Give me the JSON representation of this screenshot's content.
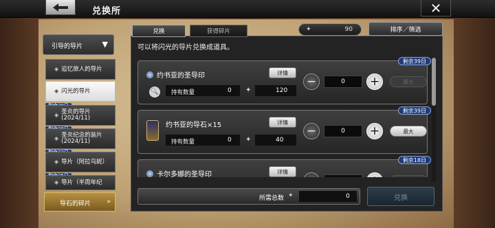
{
  "window": {
    "title": "兑换所"
  },
  "sidebar": {
    "parent_label": "引导的导片",
    "items": [
      {
        "label": "追忆旅人的导片",
        "tag": "",
        "active": false
      },
      {
        "label": "闪光的导片",
        "tag": "",
        "active": true
      },
      {
        "label": "圣炎的导片\n(2024/11)",
        "tag": "剩余39日",
        "active": false
      },
      {
        "label": "圣炎纪念的装片\n(2024/11)",
        "tag": "剩余39日",
        "active": false
      },
      {
        "label": "导片（阿拉乌妮）",
        "tag": "剩余32日",
        "active": false
      },
      {
        "label": "导片（半周年纪",
        "tag": "剩余25日",
        "active": false
      }
    ],
    "bottom_label": "导石的碎片"
  },
  "tabs": [
    {
      "label": "兑换"
    },
    {
      "label": "获得碎片"
    }
  ],
  "currency": {
    "amount": "90"
  },
  "sort_label": "排序／筛选",
  "hint": "可以将闪光的导片兑换成道具。",
  "cards": [
    {
      "name": "约书亚的圣导印",
      "badge": "剩余39日",
      "detail_label": "详情",
      "own_label": "持有数量",
      "own_value": "0",
      "cost": "120",
      "qty": "0",
      "max_label": "最大",
      "max_enabled": false
    },
    {
      "name": "约书亚的导石×15",
      "badge": "剩余39日",
      "detail_label": "详情",
      "own_label": "持有数量",
      "own_value": "0",
      "cost": "40",
      "qty": "0",
      "max_label": "最大",
      "max_enabled": true
    },
    {
      "name": "卡尔多娜的圣导印",
      "badge": "剩余18日",
      "detail_label": "详情",
      "own_label": "持有数量",
      "own_value": "0",
      "cost": "",
      "qty": "0",
      "max_label": "最大",
      "max_enabled": false
    }
  ],
  "footer": {
    "total_label": "所需总数",
    "total_value": "0",
    "exchange_label": "兑换"
  }
}
